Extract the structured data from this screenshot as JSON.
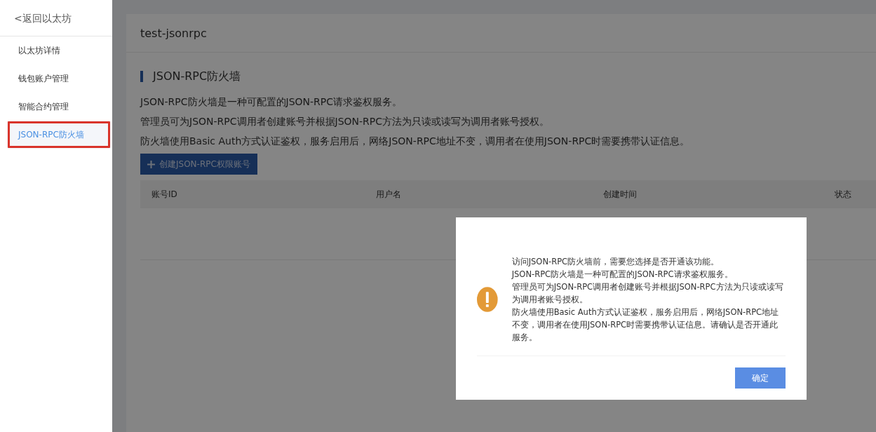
{
  "sidebar": {
    "back_link": "<返回以太坊",
    "items": [
      {
        "label": "以太坊详情",
        "selected": false,
        "highlighted": false
      },
      {
        "label": "钱包账户管理",
        "selected": false,
        "highlighted": false
      },
      {
        "label": "智能合约管理",
        "selected": false,
        "highlighted": false
      },
      {
        "label": "JSON-RPC防火墙",
        "selected": true,
        "highlighted": true
      }
    ]
  },
  "main": {
    "title": "test-jsonrpc",
    "section_title": "JSON-RPC防火墙",
    "description": [
      "JSON-RPC防火墙是一种可配置的JSON-RPC请求鉴权服务。",
      "管理员可为JSON-RPC调用者创建账号并根据JSON-RPC方法为只读或读写为调用者账号授权。",
      "防火墙使用Basic Auth方式认证鉴权，服务启用后，网络JSON-RPC地址不变，调用者在使用JSON-RPC时需要携带认证信息。"
    ],
    "create_button": "创建JSON-RPC权限账号",
    "table": {
      "columns": [
        "账号ID",
        "用户名",
        "创建时间",
        "状态"
      ]
    }
  },
  "dialog": {
    "paragraphs": [
      "访问JSON-RPC防火墙前，需要您选择是否开通该功能。",
      "JSON-RPC防火墙是一种可配置的JSON-RPC请求鉴权服务。",
      "管理员可为JSON-RPC调用者创建账号并根据JSON-RPC方法为只读或读写为调用者账号授权。",
      "防火墙使用Basic Auth方式认证鉴权，服务启用后，网络JSON-RPC地址不变，调用者在使用JSON-RPC时需要携带认证信息。请确认是否开通此服务。"
    ],
    "confirm_button": "确定"
  }
}
